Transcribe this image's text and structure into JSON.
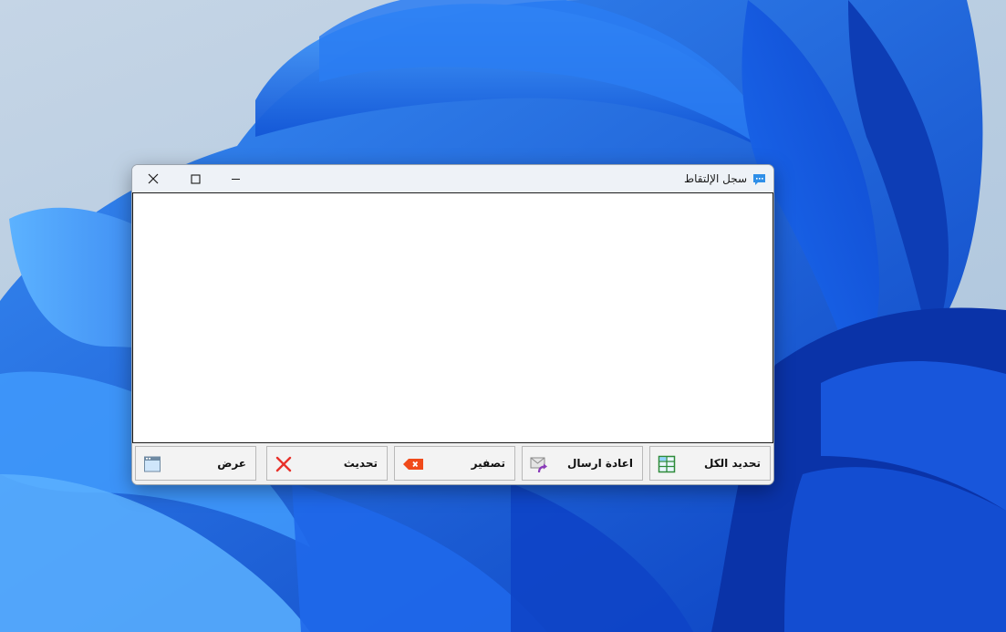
{
  "window": {
    "title": "سجل الإلتقاط",
    "title_icon": "chat-bubble-icon",
    "controls": {
      "close_icon": "close-icon",
      "maximize_icon": "maximize-icon",
      "minimize_icon": "minimize-icon"
    }
  },
  "buttons": [
    {
      "label": "تحديد الكل",
      "icon": "grid-table-icon"
    },
    {
      "label": "اعادة ارسال",
      "icon": "mail-forward-icon"
    },
    {
      "label": "تصفير",
      "icon": "clear-tag-icon"
    },
    {
      "label": "تحديث",
      "icon": "red-x-icon"
    },
    {
      "label": "عرض",
      "icon": "window-view-icon"
    }
  ],
  "colors": {
    "wallpaper_blue": "#1560e0",
    "titlebar_bg": "#eef2f7",
    "accent_blue": "#2f8fe8",
    "clear_orange": "#f04a1a",
    "x_red": "#e8312a",
    "grid_green": "#2e8b3a",
    "mail_purple": "#8a3ab9"
  }
}
